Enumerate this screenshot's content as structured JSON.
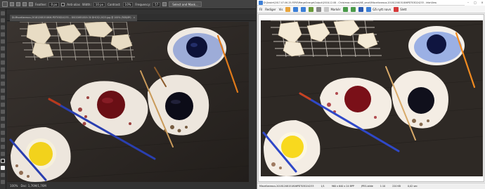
{
  "editor": {
    "options": {
      "feather_label": "Feather:",
      "feather_value": "0 px",
      "anti_alias_label": "Anti-alias",
      "width_label": "Width:",
      "width_value": "10 px",
      "contrast_label": "Contrast:",
      "contrast_value": "10%",
      "frequency_label": "Frequency:",
      "frequency_value": "57",
      "select_mask_label": "Select and Mask..."
    },
    "tab": {
      "title": "DI-Miscellaneous-20181208151806-PDT03D24233...  DSC02651819-30 DHCS2-2023.jpg @ 100% (RGB/8*)",
      "close": "×"
    },
    "status": {
      "zoom": "100%",
      "doc": "Doc: 1,76M/1,76M"
    }
  },
  "viewer": {
    "title": "D:\\AnsIre\\2017-07-06-25-FERE\\MergeOrange\\Output\\2018-12-08 - Christmas cookies\\INE_small\\Miscellaneous-20181208151806PDT03D24233 - IrfanView",
    "menu": [
      "Fil",
      "Rediger",
      "Vis"
    ],
    "toolbar": {
      "marker_label": "Markér",
      "new_window_label": "Gå nytt navn",
      "delete_label": "Slett"
    },
    "status": {
      "filename": "Miscellaneous-20181208151806PDT03D24233",
      "index": "1/1",
      "dims": "960 x 640 x 24 BPP",
      "type": "JPEG-bilde",
      "zoom": "1:10",
      "filesize": "220 KB",
      "time": "0,02 sec"
    }
  },
  "colors": {
    "red_paint": "#7a1018",
    "navy_paint": "#10143a",
    "blue_paint": "#1a2a8a",
    "yellow_paint": "#f5d21a",
    "wood": "#2e2925",
    "accent_blue": "#3c7fd6"
  }
}
